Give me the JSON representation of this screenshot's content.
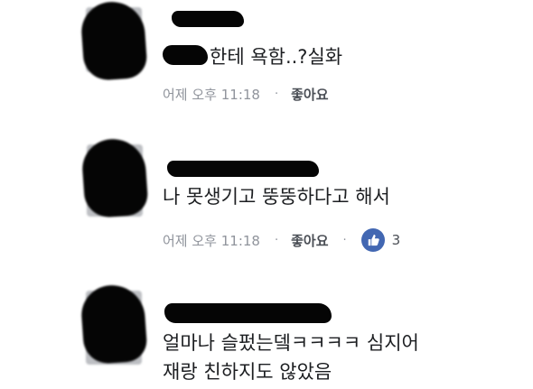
{
  "comments": [
    {
      "text": "한테 욕함..?실화",
      "time": "어제 오후 11:18",
      "separator": "·",
      "like_label": "좋아요"
    },
    {
      "text": "나 못생기고 뚱뚱하다고 해서",
      "time": "어제 오후 11:18",
      "separator": "·",
      "like_label": "좋아요",
      "separator2": "·",
      "reaction_icon": "thumbs-up-icon",
      "reaction_count": "3"
    },
    {
      "text_line1": "얼마나 슬펐는뎈ㅋㅋㅋㅋ 심지어",
      "text_line2": "재랑 친하지도 않았음"
    }
  ],
  "colors": {
    "meta_text": "#90949c",
    "reaction_blue": "#4267b2"
  }
}
